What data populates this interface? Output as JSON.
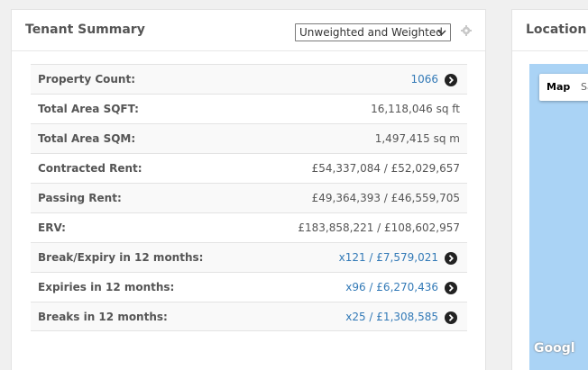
{
  "summary_panel": {
    "title": "Tenant Summary",
    "weighting_select": {
      "selected": "Unweighted and Weighted"
    },
    "rows": [
      {
        "label": "Property Count:",
        "value": "1066",
        "link": true
      },
      {
        "label": "Total Area SQFT:",
        "value": "16,118,046 sq ft",
        "link": false
      },
      {
        "label": "Total Area SQM:",
        "value": "1,497,415 sq m",
        "link": false
      },
      {
        "label": "Contracted Rent:",
        "value": "£54,337,084 / £52,029,657",
        "link": false
      },
      {
        "label": "Passing Rent:",
        "value": "£49,364,393 / £46,559,705",
        "link": false
      },
      {
        "label": "ERV:",
        "value": "£183,858,221 / £108,602,957",
        "link": false
      },
      {
        "label": "Break/Expiry in 12 months:",
        "value": "x121 / £7,579,021",
        "link": true
      },
      {
        "label": "Expiries in 12 months:",
        "value": "x96 / £6,270,436",
        "link": true
      },
      {
        "label": "Breaks in 12 months:",
        "value": "x25 / £1,308,585",
        "link": true
      }
    ]
  },
  "location_panel": {
    "title": "Location M",
    "map_type_buttons": {
      "map": "Map",
      "satellite": "Sa"
    },
    "logo": "Googl"
  },
  "colors": {
    "link": "#337ab7",
    "map_water": "#aad3f5"
  }
}
